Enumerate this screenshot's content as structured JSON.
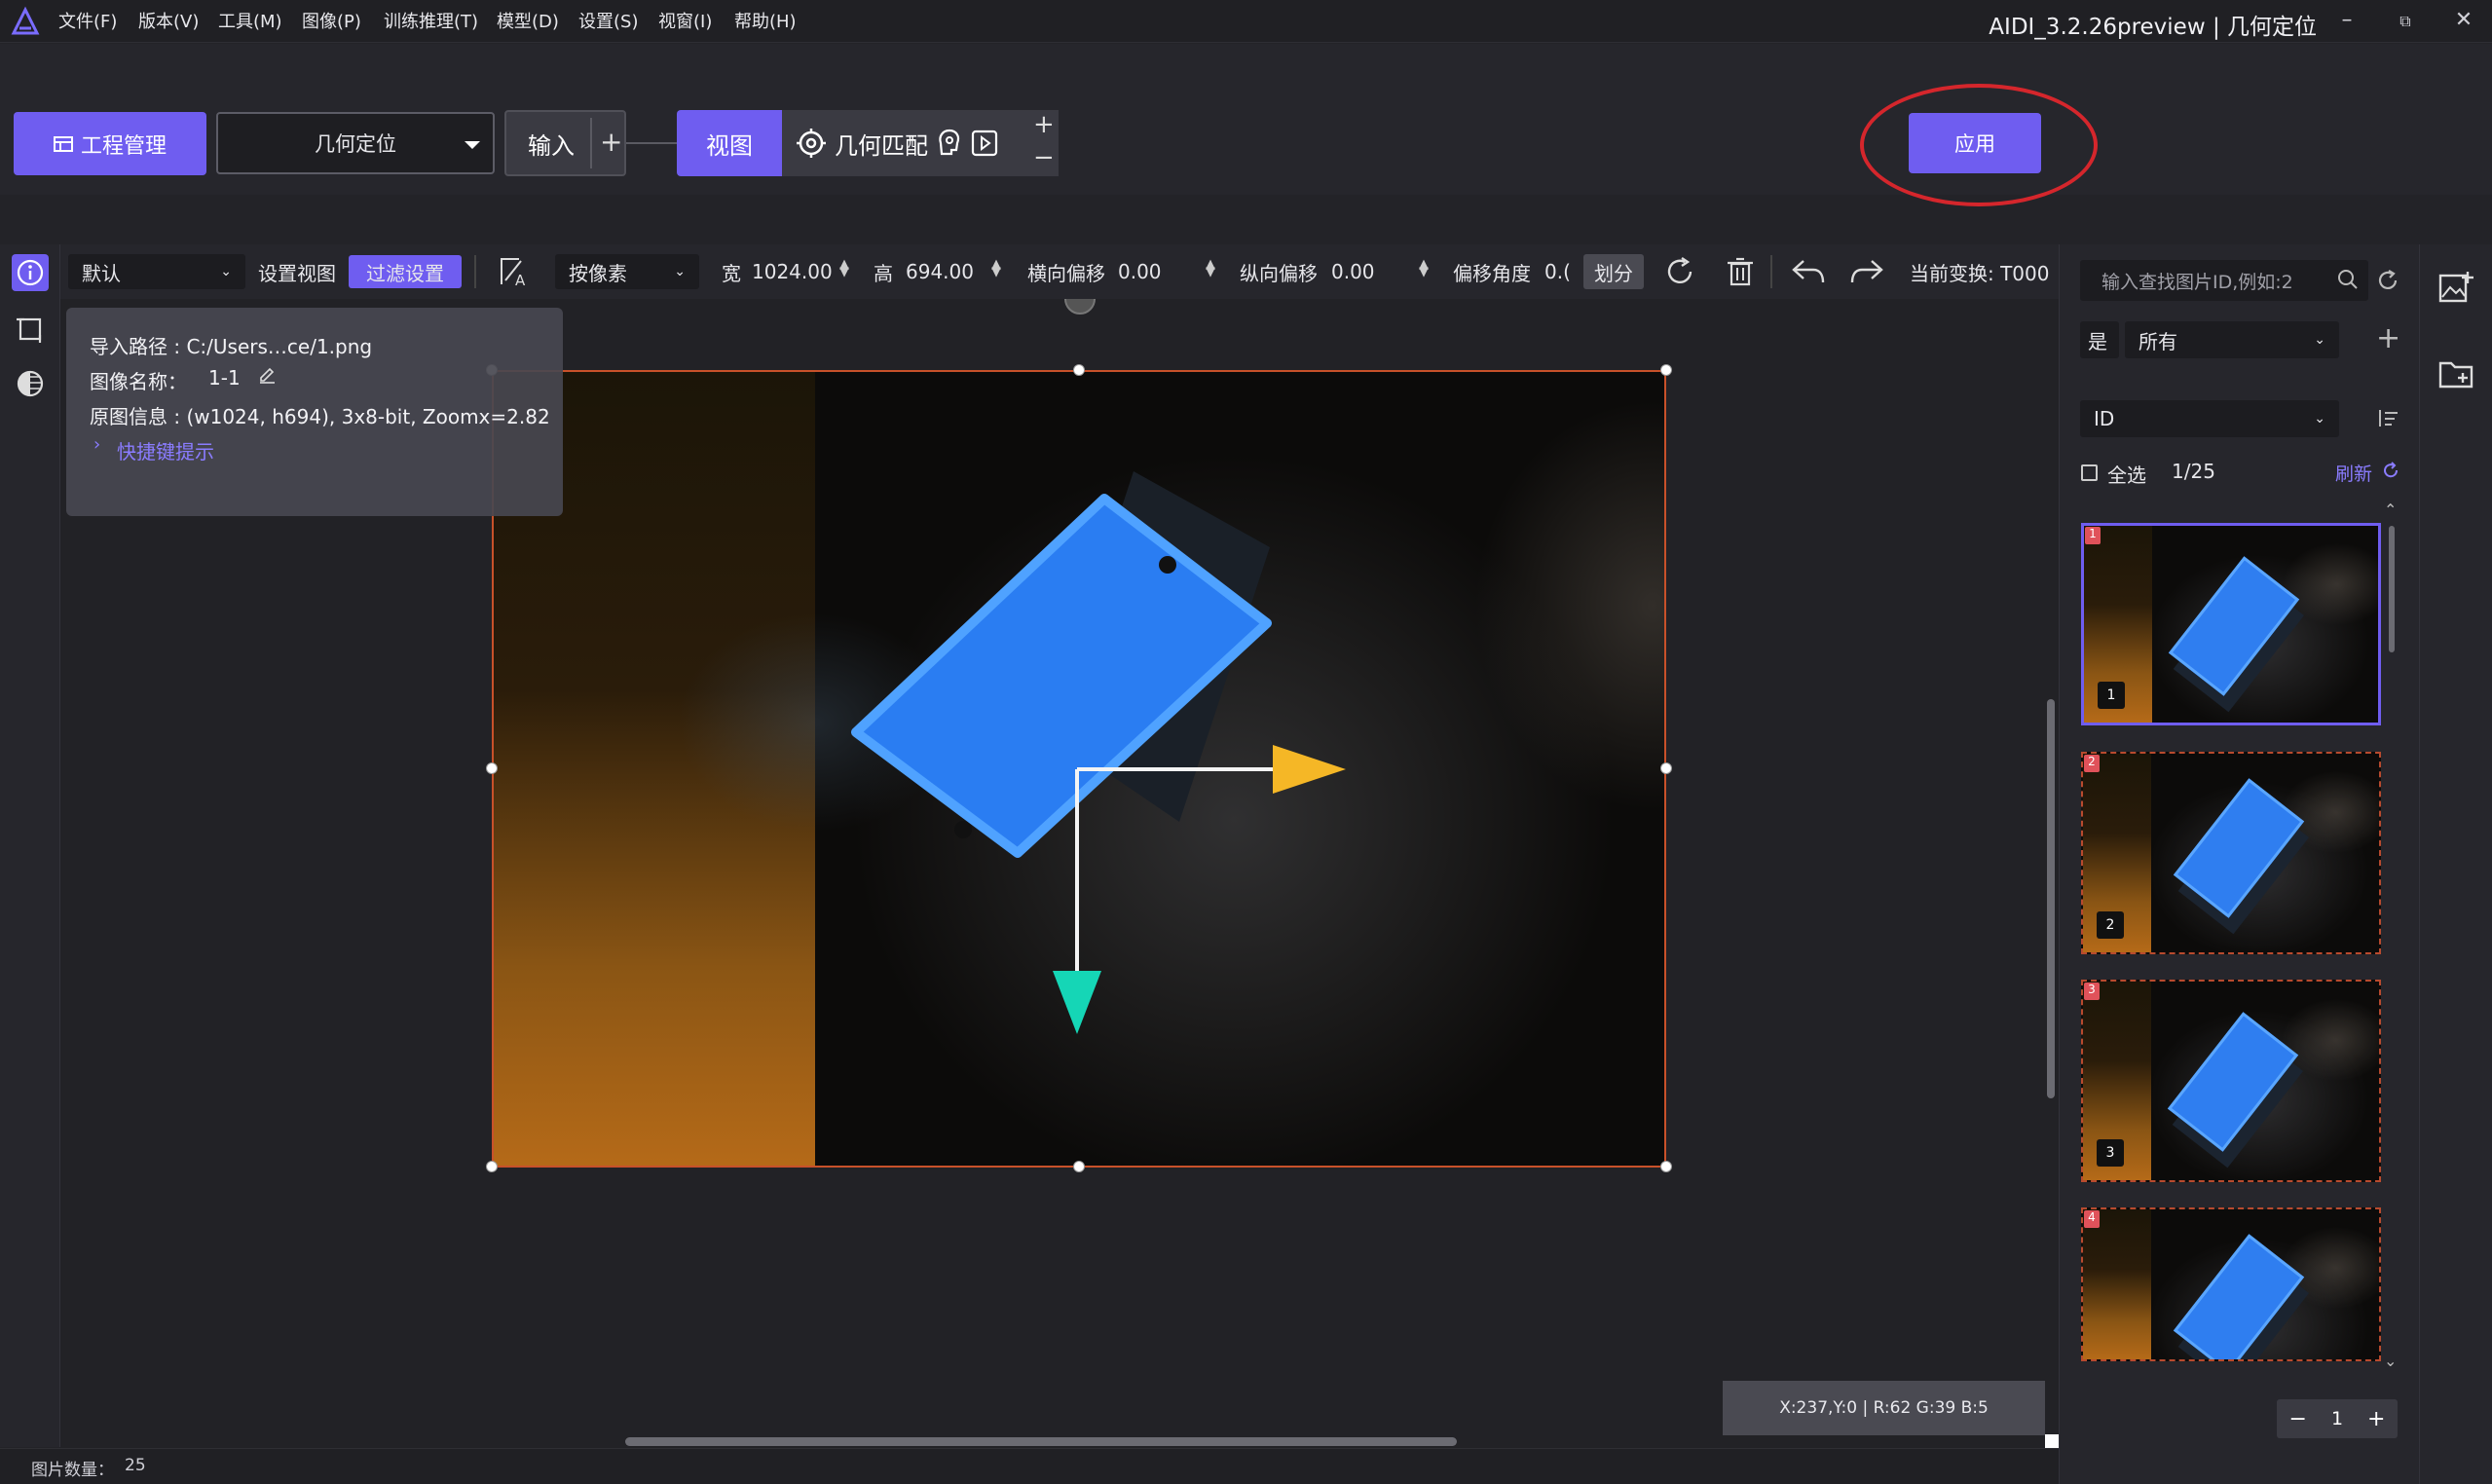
{
  "menubar": {
    "items": [
      "文件(F)",
      "版本(V)",
      "工具(M)",
      "图像(P)",
      "训练推理(T)",
      "模型(D)",
      "设置(S)",
      "视窗(I)",
      "帮助(H)"
    ],
    "title": "AIDI_3.2.26preview | 几何定位",
    "minimize": "–",
    "restore": "⧉",
    "close": "✕"
  },
  "toolbar": {
    "project_label": "工程管理",
    "mode_value": "几何定位",
    "input_label": "输入",
    "view_label": "视图",
    "geo_label": "几何匹配",
    "apply_label": "应用",
    "plus": "+",
    "minus": "−"
  },
  "toolbar2": {
    "view_select": "默认",
    "set_view_label": "设置视图",
    "filter_label": "过滤设置",
    "unit_select": "按像素",
    "width_label": "宽",
    "width_value": "1024.00",
    "height_label": "高",
    "height_value": "694.00",
    "hoffset_label": "横向偏移",
    "hoffset_value": "0.00",
    "voffset_label": "纵向偏移",
    "voffset_value": "0.00",
    "angle_label": "偏移角度",
    "angle_value": "0.(",
    "divide_label": "划分",
    "current_transform": "当前变换: T000"
  },
  "info": {
    "path": "导入路径 : C:/Users…ce/1.png",
    "name_label": "图像名称：",
    "name_value": "1-1",
    "meta": "原图信息 : (w1024, h694), 3x8-bit, Zoomx=2.82",
    "shortcut": "快捷键提示"
  },
  "canvas": {
    "coords": "X:237,Y:0 | R:62 G:39 B:5"
  },
  "right_panel": {
    "search_placeholder": "输入查找图片ID,例如:2",
    "filter_yes": "是",
    "filter_all": "所有",
    "sort_select": "ID",
    "select_all": "全选",
    "count": "1/25",
    "refresh": "刷新",
    "thumbs": [
      {
        "badge": "1",
        "num": "1"
      },
      {
        "badge": "2",
        "num": "2"
      },
      {
        "badge": "3",
        "num": "3"
      },
      {
        "badge": "4",
        "num": ""
      }
    ],
    "page": "1"
  },
  "status": {
    "count_label": "图片数量：",
    "count_value": "25"
  },
  "colors": {
    "accent": "#6f5df0",
    "highlight_ring": "#d5262c",
    "frame": "#c8512a"
  }
}
